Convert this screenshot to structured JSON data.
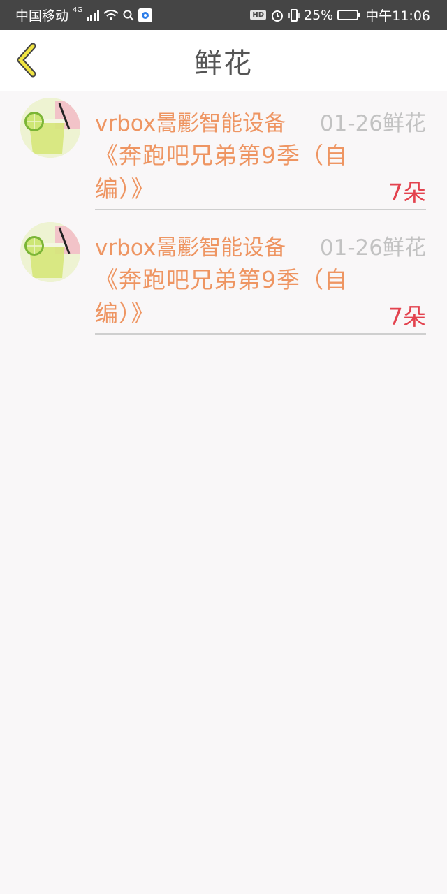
{
  "status_bar": {
    "carrier": "中国移动",
    "network_type": "4G",
    "hd": "HD",
    "battery": "25%",
    "time": "中午11:06"
  },
  "header": {
    "title": "鲜花"
  },
  "gift_list": [
    {
      "sender": "vrbox暠彲智能设备",
      "date": "01-26",
      "gift_type": "鲜花",
      "program": "《奔跑吧兄弟第9季（自编）》",
      "count": "7朵"
    },
    {
      "sender": "vrbox暠彲智能设备",
      "date": "01-26",
      "gift_type": "鲜花",
      "program": "《奔跑吧兄弟第9季（自编）》",
      "count": "7朵"
    }
  ],
  "colors": {
    "status_bar_bg": "#454545",
    "sender_orange": "#ee9562",
    "meta_gray": "#c2c2c2",
    "count_red": "#e3424e",
    "back_arrow_yellow": "#f0e442"
  },
  "icons": {
    "back": "chevron-left-icon",
    "avatar": "lemonade-drink-image"
  }
}
